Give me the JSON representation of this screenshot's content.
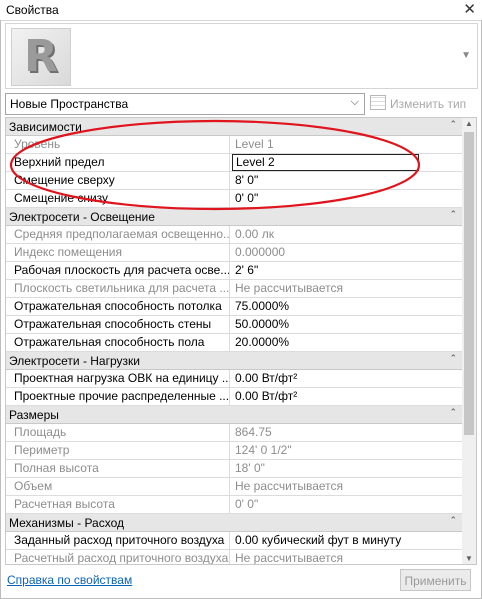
{
  "window": {
    "title": "Свойства",
    "close_icon": "close-icon"
  },
  "type_selector": {
    "value": "Новые Пространства",
    "edit_type_label": "Изменить тип",
    "logo_letter": "R"
  },
  "groups": [
    {
      "title": "Зависимости",
      "rows": [
        {
          "label": "Уровень",
          "value": "Level 1",
          "disabled": true
        },
        {
          "label": "Верхний предел",
          "value": "Level 2",
          "disabled": false,
          "editing": true
        },
        {
          "label": "Смещение сверху",
          "value": "8'  0\"",
          "disabled": false
        },
        {
          "label": "Смещение снизу",
          "value": "0'  0\"",
          "disabled": false
        }
      ]
    },
    {
      "title": "Электросети - Освещение",
      "rows": [
        {
          "label": "Средняя предполагаемая освещенно...",
          "value": "0.00 лк",
          "disabled": true
        },
        {
          "label": "Индекс помещения",
          "value": "0.000000",
          "disabled": true
        },
        {
          "label": "Рабочая плоскость для расчета осве...",
          "value": "2'  6\"",
          "disabled": false
        },
        {
          "label": "Плоскость светильника для расчета ...",
          "value": "Не рассчитывается",
          "disabled": true
        },
        {
          "label": "Отражательная способность потолка",
          "value": "75.0000%",
          "disabled": false
        },
        {
          "label": "Отражательная способность стены",
          "value": "50.0000%",
          "disabled": false
        },
        {
          "label": "Отражательная способность пола",
          "value": "20.0000%",
          "disabled": false
        }
      ]
    },
    {
      "title": "Электросети - Нагрузки",
      "rows": [
        {
          "label": "Проектная нагрузка ОВК на единицу ...",
          "value": "0.00 Вт/фт²",
          "disabled": false
        },
        {
          "label": "Проектные прочие распределенные ...",
          "value": "0.00 Вт/фт²",
          "disabled": false
        }
      ]
    },
    {
      "title": "Размеры",
      "rows": [
        {
          "label": "Площадь",
          "value": "864.75",
          "disabled": true
        },
        {
          "label": "Периметр",
          "value": "124'  0 1/2\"",
          "disabled": true
        },
        {
          "label": "Полная высота",
          "value": "18'  0\"",
          "disabled": true
        },
        {
          "label": "Объем",
          "value": "Не рассчитывается",
          "disabled": true
        },
        {
          "label": "Расчетная высота",
          "value": "0'  0\"",
          "disabled": true
        }
      ]
    },
    {
      "title": "Механизмы - Расход",
      "rows": [
        {
          "label": "Заданный расход приточного воздуха",
          "value": "0.00 кубический фут в минуту",
          "disabled": false
        },
        {
          "label": "Расчетный расход приточного воздуха",
          "value": "Не рассчитывается",
          "disabled": true
        }
      ]
    }
  ],
  "footer": {
    "help_link": "Справка по свойствам",
    "apply_button": "Применить"
  },
  "colors": {
    "annotation": "#e0141c",
    "link": "#0b63b7",
    "group_bg": "#e6e6e6"
  }
}
